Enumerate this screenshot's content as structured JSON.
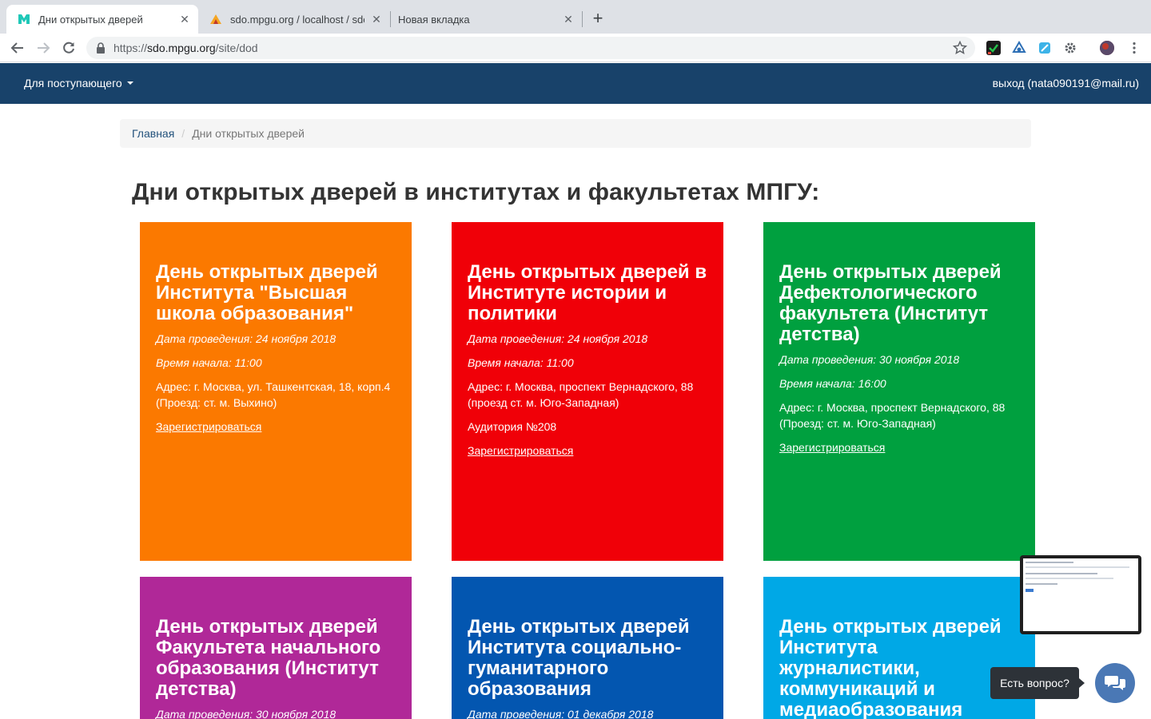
{
  "browser": {
    "tabs": [
      {
        "title": "Дни открытых дверей",
        "active": true
      },
      {
        "title": "sdo.mpgu.org / localhost / sdo",
        "active": false
      },
      {
        "title": "Новая вкладка",
        "active": false
      }
    ],
    "new_tab_symbol": "+",
    "close_symbol": "✕",
    "url_scheme": "https://",
    "url_host": "sdo.mpgu.org",
    "url_path": "/site/dod"
  },
  "navbar": {
    "menu_label": "Для поступающего",
    "logout_label": "выход (nata090191@mail.ru)",
    "bg_color": "#18426a"
  },
  "breadcrumb": {
    "home": "Главная",
    "separator": "/",
    "current": "Дни открытых дверей"
  },
  "page_title": "Дни открытых дверей в институтах и факультетах МПГУ:",
  "cards": [
    {
      "title": "День открытых дверей Института \"Высшая школа образования\"",
      "date": "Дата проведения: 24 ноября 2018",
      "time": "Время начала: 11:00",
      "address": "Адрес: г. Москва, ул. Ташкентская, 18, корп.4 (Проезд: ст. м. Выхино)",
      "room": "",
      "register": "Зарегистрироваться",
      "color": "#fb7900"
    },
    {
      "title": "День открытых дверей в Институте истории и политики",
      "date": "Дата проведения: 24 ноября 2018",
      "time": "Время начала: 11:00",
      "address": "Адрес: г. Москва, проспект Вернадского, 88 (проезд ст. м. Юго-Западная)",
      "room": "Аудитория №208",
      "register": "Зарегистрироваться",
      "color": "#f00008"
    },
    {
      "title": "День открытых дверей Дефектологического факультета (Институт детства)",
      "date": "Дата проведения: 30 ноября 2018",
      "time": "Время начала: 16:00",
      "address": "Адрес: г. Москва, проспект Вернадского, 88 (Проезд: ст. м. Юго-Западная)",
      "room": "",
      "register": "Зарегистрироваться",
      "color": "#00a03f"
    },
    {
      "title": "День открытых дверей Факультета начального образования (Институт детства)",
      "date": "Дата проведения: 30 ноября 2018",
      "time": "",
      "address": "",
      "room": "",
      "register": "",
      "color": "#b02898"
    },
    {
      "title": "День открытых дверей Института социально-гуманитарного образования",
      "date": "Дата проведения: 01 декабря 2018",
      "time": "",
      "address": "",
      "room": "",
      "register": "",
      "color": "#0356b0"
    },
    {
      "title": "День открытых дверей Института журналистики, коммуникаций и медиаобразования",
      "date": "",
      "time": "",
      "address": "",
      "room": "",
      "register": "",
      "color": "#00a8e6"
    }
  ],
  "chat": {
    "tooltip": "Есть вопрос?",
    "icon": "chat-bubbles-icon"
  }
}
